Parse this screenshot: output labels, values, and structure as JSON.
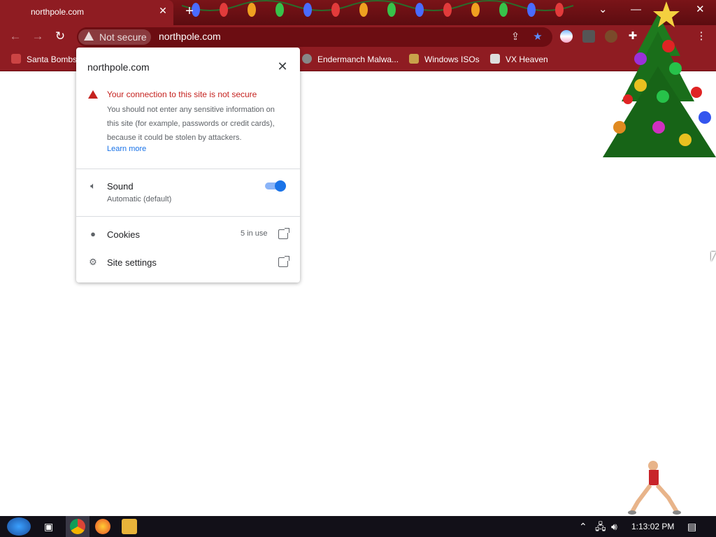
{
  "tab": {
    "title": "northpole.com"
  },
  "toolbar": {
    "not_secure": "Not secure",
    "url": "northpole.com"
  },
  "bookmarks": [
    "Santa Bombs",
    "Endermanch Malwa...",
    "Windows ISOs",
    "VX Heaven"
  ],
  "popup": {
    "site": "northpole.com",
    "warning_title": "Your connection to this site is not secure",
    "warning_body": "You should not enter any sensitive information on this site (for example, passwords or credit cards), because it could be stolen by attackers.",
    "learn_more": "Learn more",
    "sound_label": "Sound",
    "sound_sub": "Automatic (default)",
    "cookies_label": "Cookies",
    "cookies_count": "5 in use",
    "site_settings_label": "Site settings"
  },
  "taskbar": {
    "clock": "1:13:02 PM"
  },
  "colors": {
    "chrome_bg": "#8f1c22",
    "accent": "#1a73e8",
    "warning": "#c5221f"
  }
}
